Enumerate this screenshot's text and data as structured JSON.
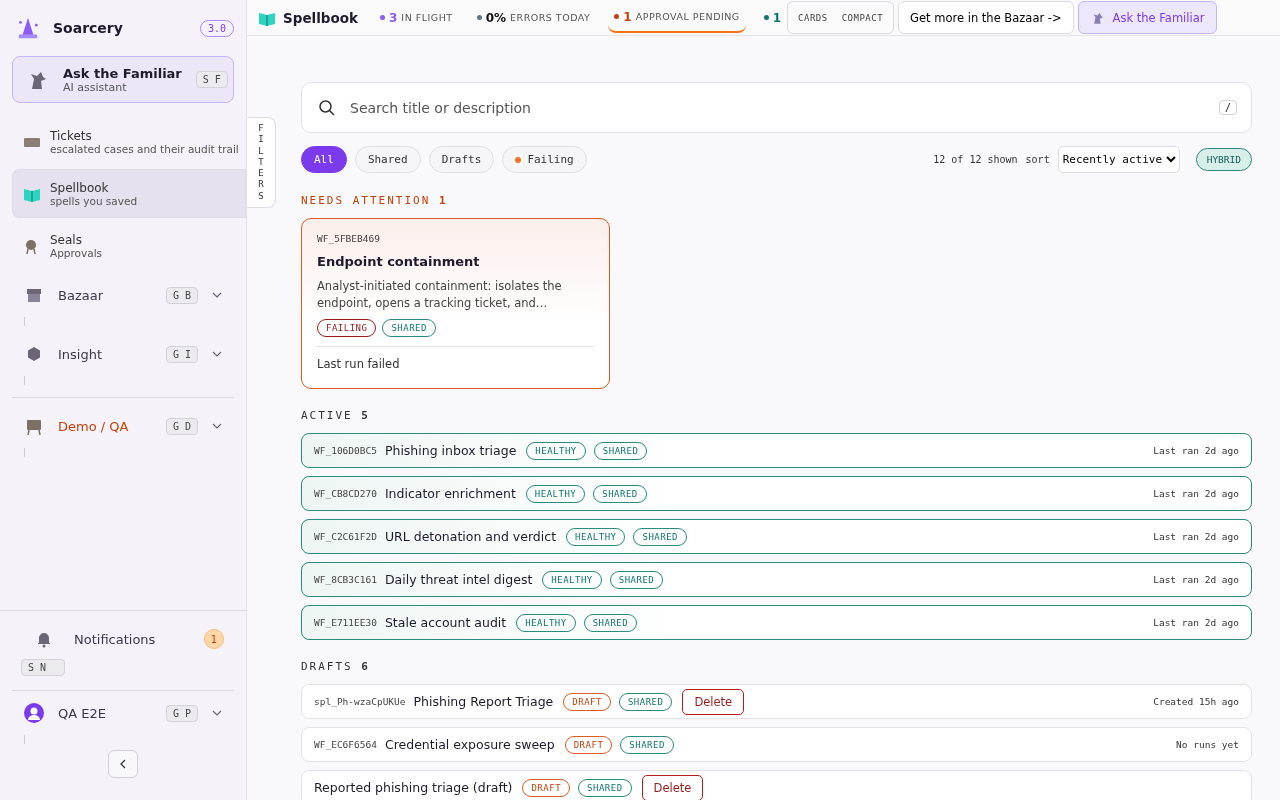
{
  "brand": {
    "name": "Soarcery",
    "version": "3.0"
  },
  "assistant": {
    "title": "Ask the Familiar",
    "subtitle": "AI assistant",
    "shortcut": "S F"
  },
  "nav": [
    {
      "kind": "link",
      "label": "Tickets",
      "sub": "escalated cases and their audit trail",
      "selected": false
    },
    {
      "kind": "link",
      "label": "Spellbook",
      "sub": "spells you saved",
      "selected": true
    },
    {
      "kind": "link",
      "label": "Seals",
      "sub": "Approvals",
      "selected": false
    },
    {
      "kind": "group",
      "label": "Bazaar",
      "shortcut": "G B",
      "highlighted": false
    },
    {
      "kind": "group",
      "label": "Insight",
      "shortcut": "G I",
      "highlighted": false
    },
    {
      "kind": "divider"
    },
    {
      "kind": "group",
      "label": "Demo / QA",
      "shortcut": "G D",
      "highlighted": true
    }
  ],
  "notifications": {
    "label": "Notifications",
    "count": "1",
    "shortcut": "S N"
  },
  "user": {
    "name": "QA E2E",
    "shortcut": "G P"
  },
  "topbar": {
    "title": "Spellbook",
    "stats": [
      {
        "value": "3",
        "label": "IN FLIGHT",
        "color": "#8b5cf6",
        "selected": false
      },
      {
        "value": "0%",
        "label": "ERRORS TODAY",
        "color": "#64748b",
        "selected": false
      },
      {
        "value": "1",
        "label": "APPROVAL PENDING",
        "color": "#c2410c",
        "selected": true
      },
      {
        "value": "1",
        "color": "#0f766e",
        "selected": false
      }
    ],
    "views": [
      "CARDS",
      "COMPACT"
    ],
    "bazaar": "Get more in the Bazaar ->",
    "familiar": "Ask the Familiar"
  },
  "filters_tab": "FILTERS",
  "search": {
    "placeholder": "Search title or description",
    "key": "/"
  },
  "chips": [
    {
      "label": "All",
      "selected": true
    },
    {
      "label": "Shared",
      "selected": false
    },
    {
      "label": "Drafts",
      "selected": false
    },
    {
      "label": "Failing",
      "selected": false,
      "color": "#f97316"
    }
  ],
  "count": "12 of 12 shown",
  "sort_label": "sort",
  "sort": "Recently active",
  "mode": "HYBRID",
  "attention": {
    "title": "NEEDS ATTENTION",
    "count": "1",
    "cards": [
      {
        "id": "WF_5FBEB469",
        "title": "Endpoint containment",
        "description": "Analyst-initiated containment: isolates the endpoint, opens a tracking ticket, and…",
        "tags": [
          {
            "label": "FAILING",
            "kind": "failing"
          },
          {
            "label": "SHARED",
            "kind": "shared"
          }
        ],
        "status": "Last run failed"
      }
    ]
  },
  "sections": [
    {
      "title": "ACTIVE",
      "count": "5",
      "kind": "active",
      "rows": [
        {
          "id": "WF_106D0BC5",
          "title": "Phishing inbox triage",
          "tags": [
            {
              "label": "HEALTHY",
              "kind": "healthy"
            },
            {
              "label": "SHARED",
              "kind": "shared"
            }
          ],
          "time": "Last ran 2d ago"
        },
        {
          "id": "WF_CB8CD270",
          "title": "Indicator enrichment",
          "tags": [
            {
              "label": "HEALTHY",
              "kind": "healthy"
            },
            {
              "label": "SHARED",
              "kind": "shared"
            }
          ],
          "time": "Last ran 2d ago"
        },
        {
          "id": "WF_C2C61F2D",
          "title": "URL detonation and verdict",
          "tags": [
            {
              "label": "HEALTHY",
              "kind": "healthy"
            },
            {
              "label": "SHARED",
              "kind": "shared"
            }
          ],
          "time": "Last ran 2d ago"
        },
        {
          "id": "WF_8CB3C161",
          "title": "Daily threat intel digest",
          "tags": [
            {
              "label": "HEALTHY",
              "kind": "healthy"
            },
            {
              "label": "SHARED",
              "kind": "shared"
            }
          ],
          "time": "Last ran 2d ago"
        },
        {
          "id": "WF_E711EE30",
          "title": "Stale account audit",
          "tags": [
            {
              "label": "HEALTHY",
              "kind": "healthy"
            },
            {
              "label": "SHARED",
              "kind": "shared"
            }
          ],
          "time": "Last ran 2d ago"
        }
      ]
    },
    {
      "title": "DRAFTS",
      "count": "6",
      "kind": "draft",
      "rows": [
        {
          "id": "spl_Ph-wzaCpUKUe",
          "title": "Phishing Report Triage",
          "tags": [
            {
              "label": "DRAFT",
              "kind": "draft"
            },
            {
              "label": "SHARED",
              "kind": "shared"
            }
          ],
          "action": "Delete",
          "time": "Created 15h ago"
        },
        {
          "id": "WF_EC6F6564",
          "title": "Credential exposure sweep",
          "tags": [
            {
              "label": "DRAFT",
              "kind": "draft"
            },
            {
              "label": "SHARED",
              "kind": "shared"
            }
          ],
          "time": "No runs yet"
        },
        {
          "title": "Reported phishing triage (draft)",
          "tags": [
            {
              "label": "DRAFT",
              "kind": "draft"
            },
            {
              "label": "SHARED",
              "kind": "shared"
            }
          ],
          "action": "Delete"
        }
      ]
    }
  ]
}
